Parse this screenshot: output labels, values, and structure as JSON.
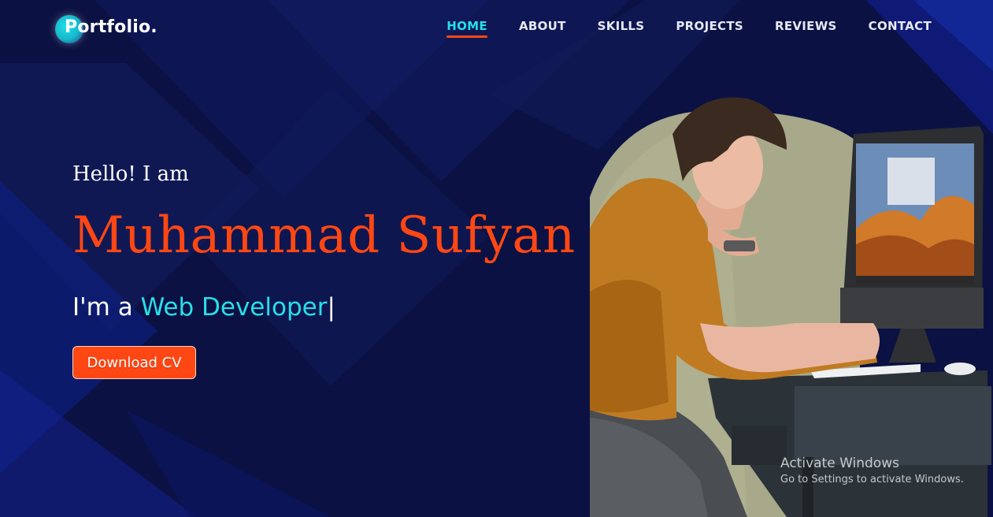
{
  "header": {
    "logo_text": "Portfolio.",
    "nav": [
      {
        "label": "HOME",
        "active": true
      },
      {
        "label": "ABOUT",
        "active": false
      },
      {
        "label": "SKILLS",
        "active": false
      },
      {
        "label": "PROJECTS",
        "active": false
      },
      {
        "label": "REVIEWS",
        "active": false
      },
      {
        "label": "CONTACT",
        "active": false
      }
    ]
  },
  "hero": {
    "greeting": "Hello! I am",
    "name": "Muhammad Sufyan",
    "role_prefix": "I'm a ",
    "role_typed": "Web Developer",
    "cursor": "|",
    "cta_label": "Download CV"
  },
  "watermark": {
    "title": "Activate Windows",
    "subtitle": "Go to Settings to activate Windows."
  },
  "colors": {
    "background": "#0b1142",
    "accent_orange": "#ff4713",
    "accent_cyan": "#27dfe9"
  }
}
